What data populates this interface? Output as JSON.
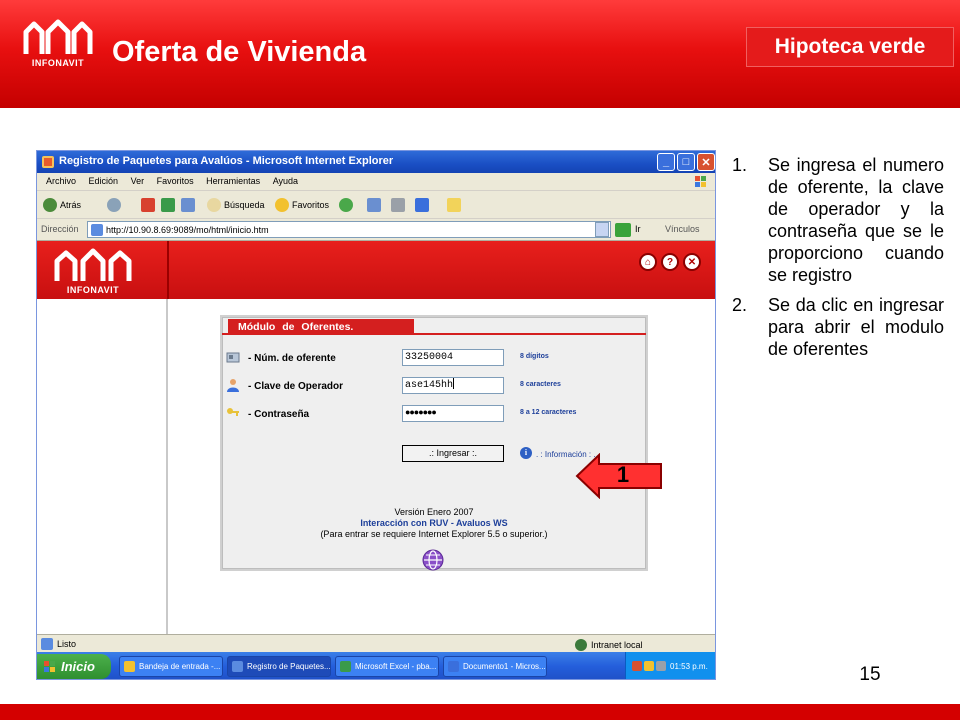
{
  "slide": {
    "logo_text": "INFONAVIT",
    "title": "Oferta de Vivienda",
    "badge": "Hipoteca verde",
    "page_number": "15",
    "colors": {
      "primary_red": "#e41b1b",
      "dark_red": "#c40000"
    }
  },
  "instructions": [
    {
      "num": "1.",
      "text": "Se ingresa el numero de oferente, la clave de operador y la contraseña que se le proporciono cuando se registro"
    },
    {
      "num": "2.",
      "text": "Se da clic en ingresar para abrir el modulo de oferentes"
    }
  ],
  "browser": {
    "title": "Registro de Paquetes para Avalúos - Microsoft Internet Explorer",
    "menu": [
      "Archivo",
      "Edición",
      "Ver",
      "Favoritos",
      "Herramientas",
      "Ayuda"
    ],
    "toolbar": {
      "back": "Atrás",
      "search": "Búsqueda",
      "favorites": "Favoritos"
    },
    "address_label": "Dirección",
    "url": "http://10.90.8.69:9089/mo/html/inicio.htm",
    "go_label": "Ir",
    "links_label": "Vínculos",
    "status_text": "Listo",
    "zone_text": "Intranet local"
  },
  "site": {
    "logo_text": "INFONAVIT",
    "controls": {
      "home": "⌂",
      "help": "?",
      "close": "✕"
    }
  },
  "panel": {
    "title": "Módulo de Oferentes.",
    "fields": [
      {
        "label": "-  Núm. de oferente",
        "value": "33250004",
        "hint": "8 dígitos"
      },
      {
        "label": "-  Clave de Operador",
        "value": "ase145hh",
        "hint": "8 caracteres"
      },
      {
        "label": "-  Contraseña",
        "value": "●●●●●●●",
        "hint": "8 a 12 caracteres"
      }
    ],
    "submit_label": ".: Ingresar :.",
    "info_label": ". : Información : .",
    "version_line1": "Versión Enero 2007",
    "version_line2": "Interacción con RUV - Avaluos WS",
    "version_line3": "(Para entrar se requiere Internet Explorer 5.5 o superior.)"
  },
  "callout": {
    "label": "1"
  },
  "taskbar": {
    "start_label": "Inicio",
    "items": [
      {
        "label": "Bandeja de entrada -...",
        "active": false
      },
      {
        "label": "Registro de Paquetes...",
        "active": true
      },
      {
        "label": "Microsoft Excel - pba...",
        "active": false
      },
      {
        "label": "Documento1 - Micros...",
        "active": false
      }
    ],
    "clock": "01:53 p.m."
  }
}
